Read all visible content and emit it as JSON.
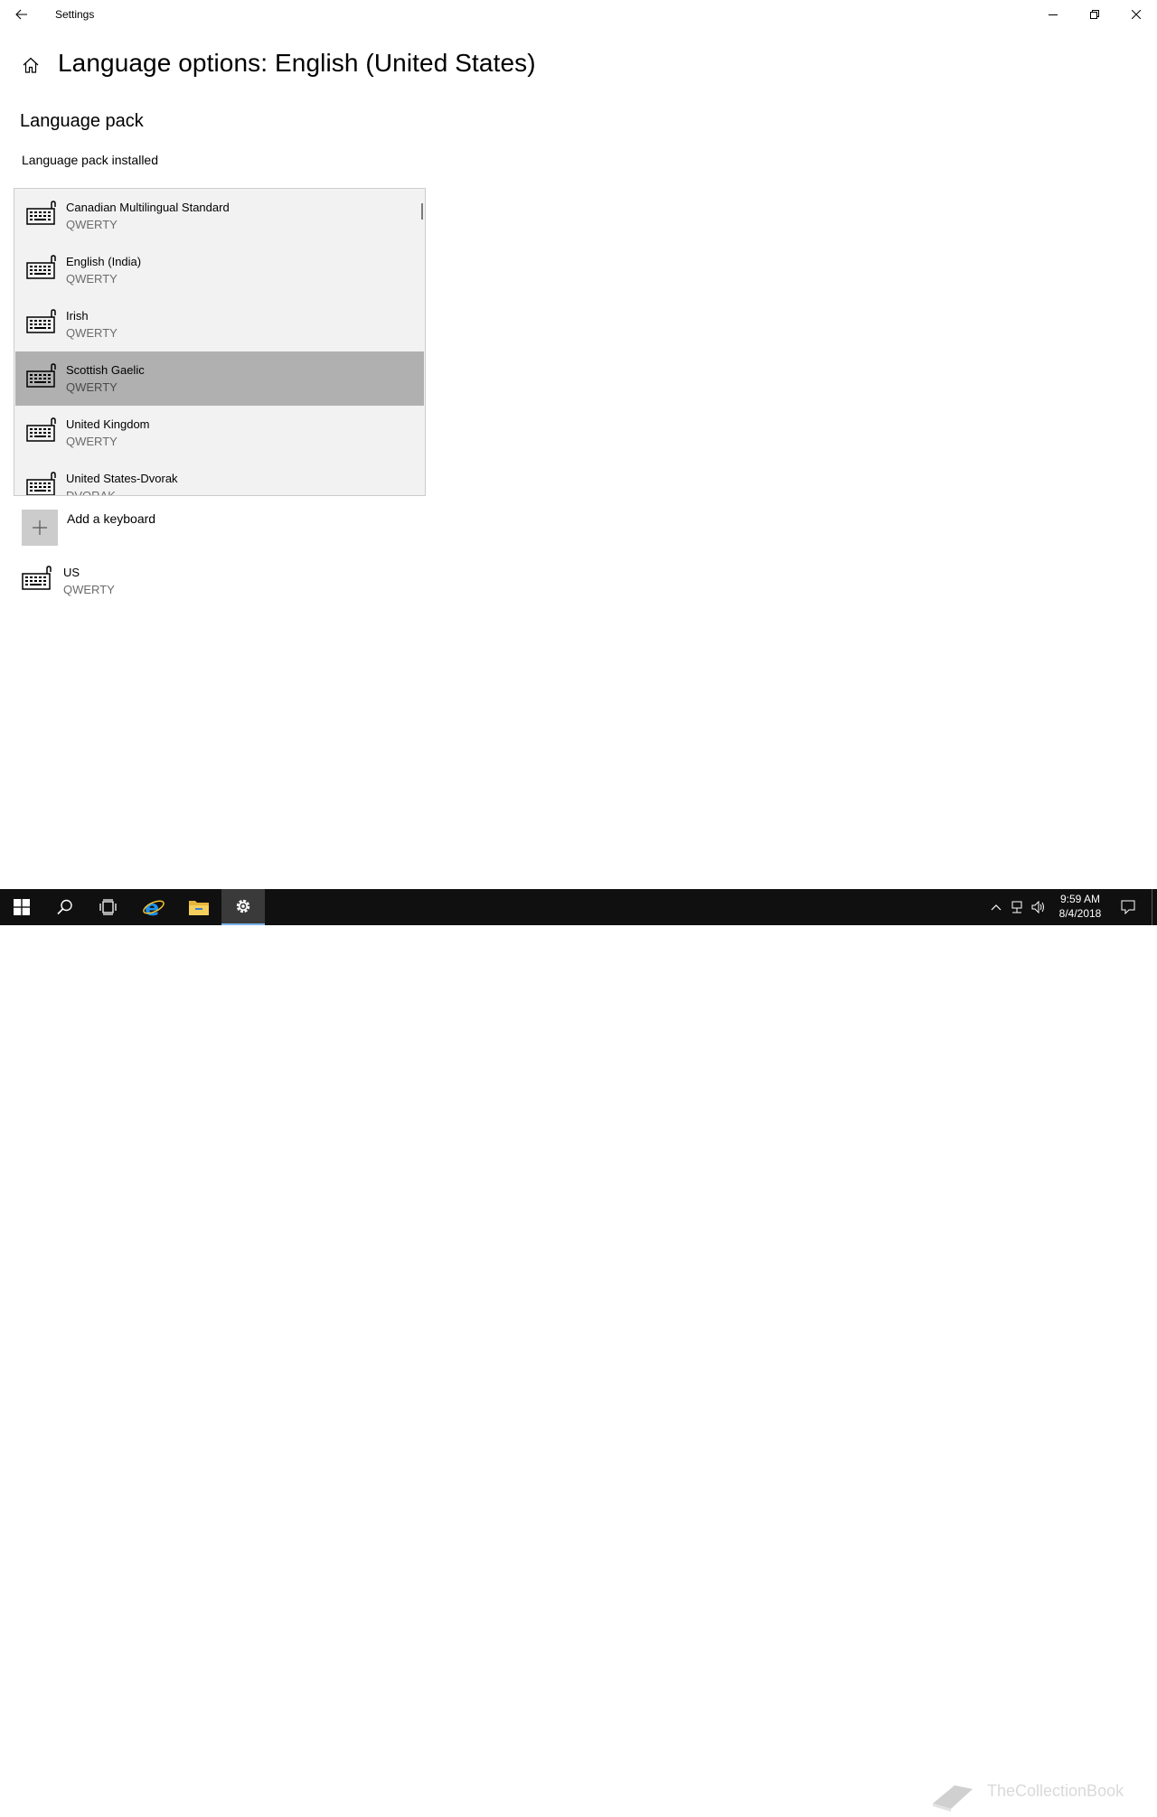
{
  "window": {
    "title": "Settings"
  },
  "header": {
    "page_title": "Language options: English (United States)"
  },
  "language_pack": {
    "section_title": "Language pack",
    "status": "Language pack installed"
  },
  "keyboard_dropdown": {
    "items": [
      {
        "name": "Canadian Multilingual Standard",
        "layout": "QWERTY",
        "selected": false
      },
      {
        "name": "English (India)",
        "layout": "QWERTY",
        "selected": false
      },
      {
        "name": "Irish",
        "layout": "QWERTY",
        "selected": false
      },
      {
        "name": "Scottish Gaelic",
        "layout": "QWERTY",
        "selected": true
      },
      {
        "name": "United Kingdom",
        "layout": "QWERTY",
        "selected": false
      },
      {
        "name": "United States-Dvorak",
        "layout": "DVORAK",
        "selected": false
      }
    ]
  },
  "add_keyboard": {
    "label": "Add a keyboard"
  },
  "installed_keyboard": {
    "name": "US",
    "layout": "QWERTY"
  },
  "taskbar": {
    "time": "9:59 AM",
    "date": "8/4/2018",
    "watermark": "TheCollectionBook"
  },
  "colors": {
    "selected_item": "#b0b0b0",
    "taskbar": "#101010",
    "accent": "#0078d7"
  }
}
